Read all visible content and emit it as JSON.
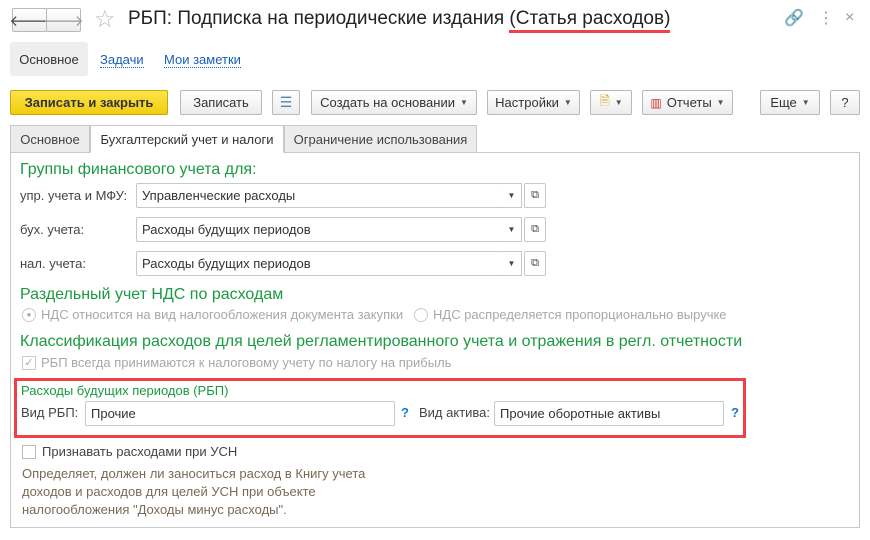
{
  "window": {
    "title_main": "РБП: Подписка на периодические издания ",
    "title_highlight": "(Статья расходов)"
  },
  "nav": {
    "links": [
      "Основное",
      "Задачи",
      "Мои заметки"
    ]
  },
  "toolbar": {
    "save_close": "Записать и закрыть",
    "save": "Записать",
    "create_based": "Создать на основании",
    "settings": "Настройки",
    "reports": "Отчеты",
    "more": "Еще",
    "help": "?"
  },
  "tabs": [
    "Основное",
    "Бухгалтерский учет и налоги",
    "Ограничение использования"
  ],
  "groups": {
    "title": "Группы финансового учета для:",
    "rows": [
      {
        "label": "упр. учета и МФУ:",
        "value": "Управленческие расходы"
      },
      {
        "label": "бух. учета:",
        "value": "Расходы будущих периодов"
      },
      {
        "label": "нал. учета:",
        "value": "Расходы будущих периодов"
      }
    ]
  },
  "vat": {
    "title": "Раздельный учет НДС по расходам",
    "option1": "НДС относится на вид налогообложения документа закупки",
    "option2": "НДС распределяется пропорционально выручке"
  },
  "classification": {
    "title": "Классификация расходов для целей регламентированного учета и отражения в регл. отчетности",
    "checkbox": "РБП всегда принимаются к налоговому учету по налогу на прибыль"
  },
  "rbp": {
    "title": "Расходы будущих периодов (РБП)",
    "kind_label": "Вид РБП:",
    "kind_value": "Прочие",
    "asset_label": "Вид актива:",
    "asset_value": "Прочие оборотные активы",
    "help": "?"
  },
  "usn": {
    "checkbox": "Признавать расходами при УСН",
    "desc": [
      "Определяет, должен ли заноситься расход в Книгу учета",
      "доходов и расходов для целей УСН при объекте",
      "налогообложения \"Доходы минус расходы\"."
    ]
  }
}
